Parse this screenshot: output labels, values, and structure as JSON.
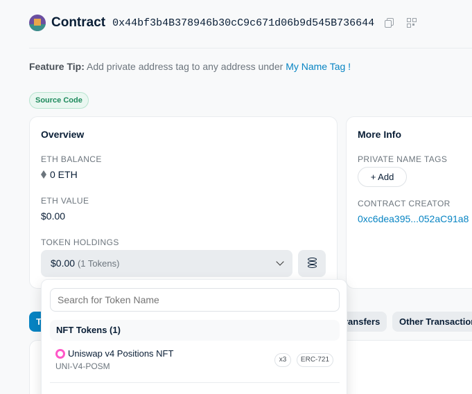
{
  "header": {
    "title": "Contract",
    "address": "0x44bf3b4B378946b30cC9c671d06b9d545B736644",
    "icons": [
      "avatar",
      "copy-icon",
      "qr-code-icon"
    ]
  },
  "feature_tip": {
    "label": "Feature Tip:",
    "text": "Add private address tag to any address under",
    "link": "My Name Tag !"
  },
  "source_code_badge": "Source Code",
  "overview": {
    "title": "Overview",
    "eth_balance_label": "ETH BALANCE",
    "eth_balance_value": "0 ETH",
    "eth_value_label": "ETH VALUE",
    "eth_value_value": "$0.00",
    "token_holdings_label": "TOKEN HOLDINGS",
    "token_holdings_amount": "$0.00",
    "token_holdings_count": "(1 Tokens)"
  },
  "more_info": {
    "title": "More Info",
    "private_name_tags_label": "PRIVATE NAME TAGS",
    "add_button": "+ Add",
    "contract_creator_label": "CONTRACT CREATOR",
    "contract_creator_value": "0xc6dea395...052aC91a8"
  },
  "tabs": {
    "transfers": "ransfers",
    "other": "Other Transactions"
  },
  "token_dropdown": {
    "search_placeholder": "Search for Token Name",
    "group_header": "NFT Tokens (1)",
    "tokens": [
      {
        "name": "Uniswap v4 Positions NFT",
        "symbol": "UNI-V4-POSM",
        "quantity_badge": "x3",
        "standard_badge": "ERC-721"
      }
    ]
  },
  "colors": {
    "link": "#0784c3",
    "badge_green": "#1f8a5d",
    "text_primary": "#081d35",
    "text_muted": "#6c757d"
  }
}
